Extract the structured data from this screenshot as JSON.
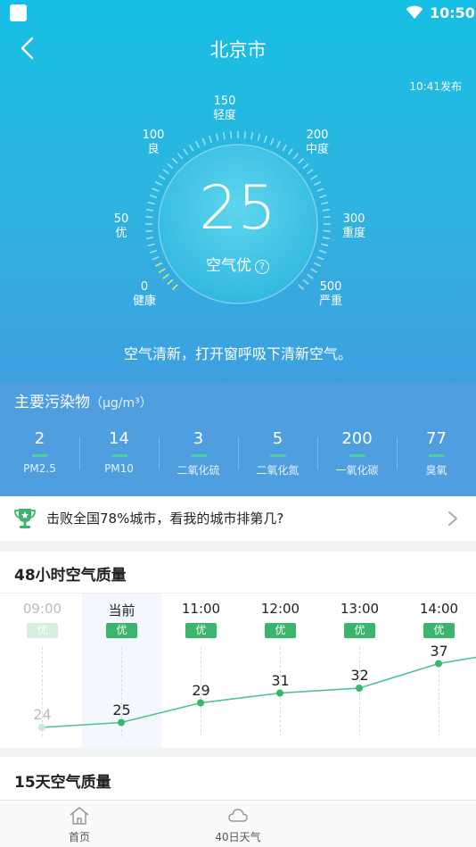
{
  "status_bar": {
    "time": "10:50"
  },
  "header": {
    "city": "北京市",
    "publish_time": "10:41发布"
  },
  "gauge": {
    "value": "25",
    "level": "空气优",
    "help": "?",
    "scale": [
      {
        "value": "0",
        "label": "健康"
      },
      {
        "value": "50",
        "label": "优"
      },
      {
        "value": "100",
        "label": "良"
      },
      {
        "value": "150",
        "label": "轻度"
      },
      {
        "value": "200",
        "label": "中度"
      },
      {
        "value": "300",
        "label": "重度"
      },
      {
        "value": "500",
        "label": "严重"
      }
    ],
    "advice": "空气清新，打开窗呼吸下清新空气。"
  },
  "pollutants": {
    "title": "主要污染物",
    "unit": "（μg/m³）",
    "items": [
      {
        "value": "2",
        "name": "PM2.5"
      },
      {
        "value": "14",
        "name": "PM10"
      },
      {
        "value": "3",
        "name": "二氧化硫"
      },
      {
        "value": "5",
        "name": "二氧化氮"
      },
      {
        "value": "200",
        "name": "一氧化碳"
      },
      {
        "value": "77",
        "name": "臭氧"
      }
    ]
  },
  "rank": {
    "text": "击败全国78%城市，看我的城市排第几?"
  },
  "hourly": {
    "title": "48小时空气质量",
    "items": [
      {
        "time": "09:00",
        "level": "优",
        "aqi": 24,
        "label": "24",
        "state": "past"
      },
      {
        "time": "当前",
        "level": "优",
        "aqi": 25,
        "label": "25",
        "state": "current"
      },
      {
        "time": "11:00",
        "level": "优",
        "aqi": 29,
        "label": "29",
        "state": "future"
      },
      {
        "time": "12:00",
        "level": "优",
        "aqi": 31,
        "label": "31",
        "state": "future"
      },
      {
        "time": "13:00",
        "level": "优",
        "aqi": 32,
        "label": "32",
        "state": "future"
      },
      {
        "time": "14:00",
        "level": "优",
        "aqi": 37,
        "label": "37",
        "state": "future"
      }
    ]
  },
  "daily": {
    "title": "15天空气质量"
  },
  "bottom_nav": [
    {
      "label": "首页",
      "icon": "home-icon"
    },
    {
      "label": "40日天气",
      "icon": "cloud-icon"
    },
    {
      "label": "",
      "icon": ""
    }
  ],
  "colors": {
    "good": "#3cb56c",
    "line": "#4cc38a",
    "hero_top": "#16bfe3",
    "hero_bottom": "#3e9fe0"
  }
}
